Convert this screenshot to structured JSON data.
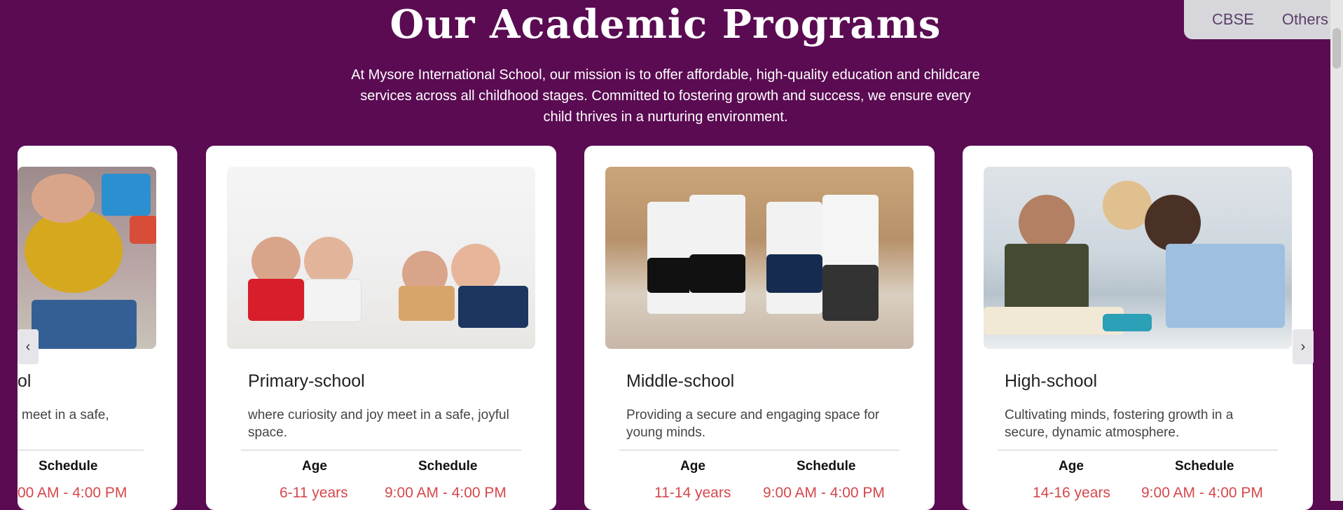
{
  "top_tabs": [
    "CBSE",
    "Others"
  ],
  "heading": "Our Academic Programs",
  "intro": "At Mysore International School, our mission is to offer affordable, high-quality education and childcare services across all childhood stages. Committed to fostering growth and success, we ensure every child thrives in a nurturing environment.",
  "partial_card": {
    "title_tail": "ol",
    "desc_tail": "meet in a safe,",
    "schedule_label": "Schedule",
    "schedule_value": "00 AM - 4:00 PM"
  },
  "cards": [
    {
      "title": "Primary-school",
      "description": "where curiosity and joy meet in a safe, joyful space.",
      "age_label": "Age",
      "schedule_label": "Schedule",
      "age": "6-11 years",
      "schedule": "9:00 AM - 4:00 PM"
    },
    {
      "title": "Middle-school",
      "description": "Providing a secure and engaging space for young minds.",
      "age_label": "Age",
      "schedule_label": "Schedule",
      "age": "11-14 years",
      "schedule": "9:00 AM - 4:00 PM"
    },
    {
      "title": "High-school",
      "description": "Cultivating minds, fostering growth in a secure, dynamic atmosphere.",
      "age_label": "Age",
      "schedule_label": "Schedule",
      "age": "14-16 years",
      "schedule": "9:00 AM - 4:00 PM"
    }
  ],
  "arrows": {
    "prev": "‹",
    "next": "›"
  },
  "colors": {
    "background": "#5a0b52",
    "accent_value": "#d5474b",
    "tab_bg": "#d7d7db",
    "tab_text": "#5c3f6a"
  }
}
